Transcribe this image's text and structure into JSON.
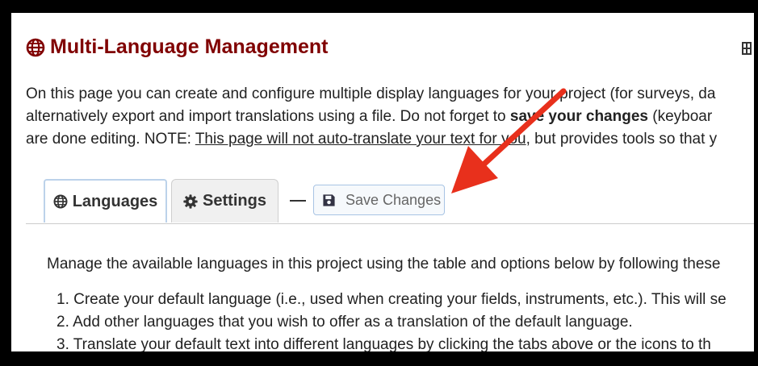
{
  "header": {
    "title": "Multi-Language Management"
  },
  "intro": {
    "line1": "On this page you can create and configure multiple display languages for your project (for surveys, da",
    "line2_before": "alternatively export and import translations using a file. Do not forget to ",
    "line2_bold": "save your changes",
    "line2_after": " (keyboar",
    "line3_before": "are done editing. NOTE: ",
    "line3_underline": "This page will not auto-translate your text for you",
    "line3_after": ", but provides tools so that y"
  },
  "tabs": [
    {
      "label": "Languages",
      "icon": "globe-icon",
      "active": true
    },
    {
      "label": "Settings",
      "icon": "gear-icon",
      "active": false
    }
  ],
  "save_button": {
    "label": "Save Changes",
    "icon": "floppy-disk-icon"
  },
  "content": {
    "manage_text": "Manage the available languages in this project using the table and options below by following these",
    "steps": [
      "1. Create your default language (i.e., used when creating your fields, instruments, etc.). This will se",
      "2. Add other languages that you wish to offer as a translation of the default language.",
      "3. Translate your default text into different languages by clicking the tabs above or the icons to th"
    ]
  },
  "colors": {
    "title": "#800000",
    "arrow": "#e8301c",
    "active_tab_border": "#bcd2ea",
    "save_button_border": "#a8c4e4"
  }
}
